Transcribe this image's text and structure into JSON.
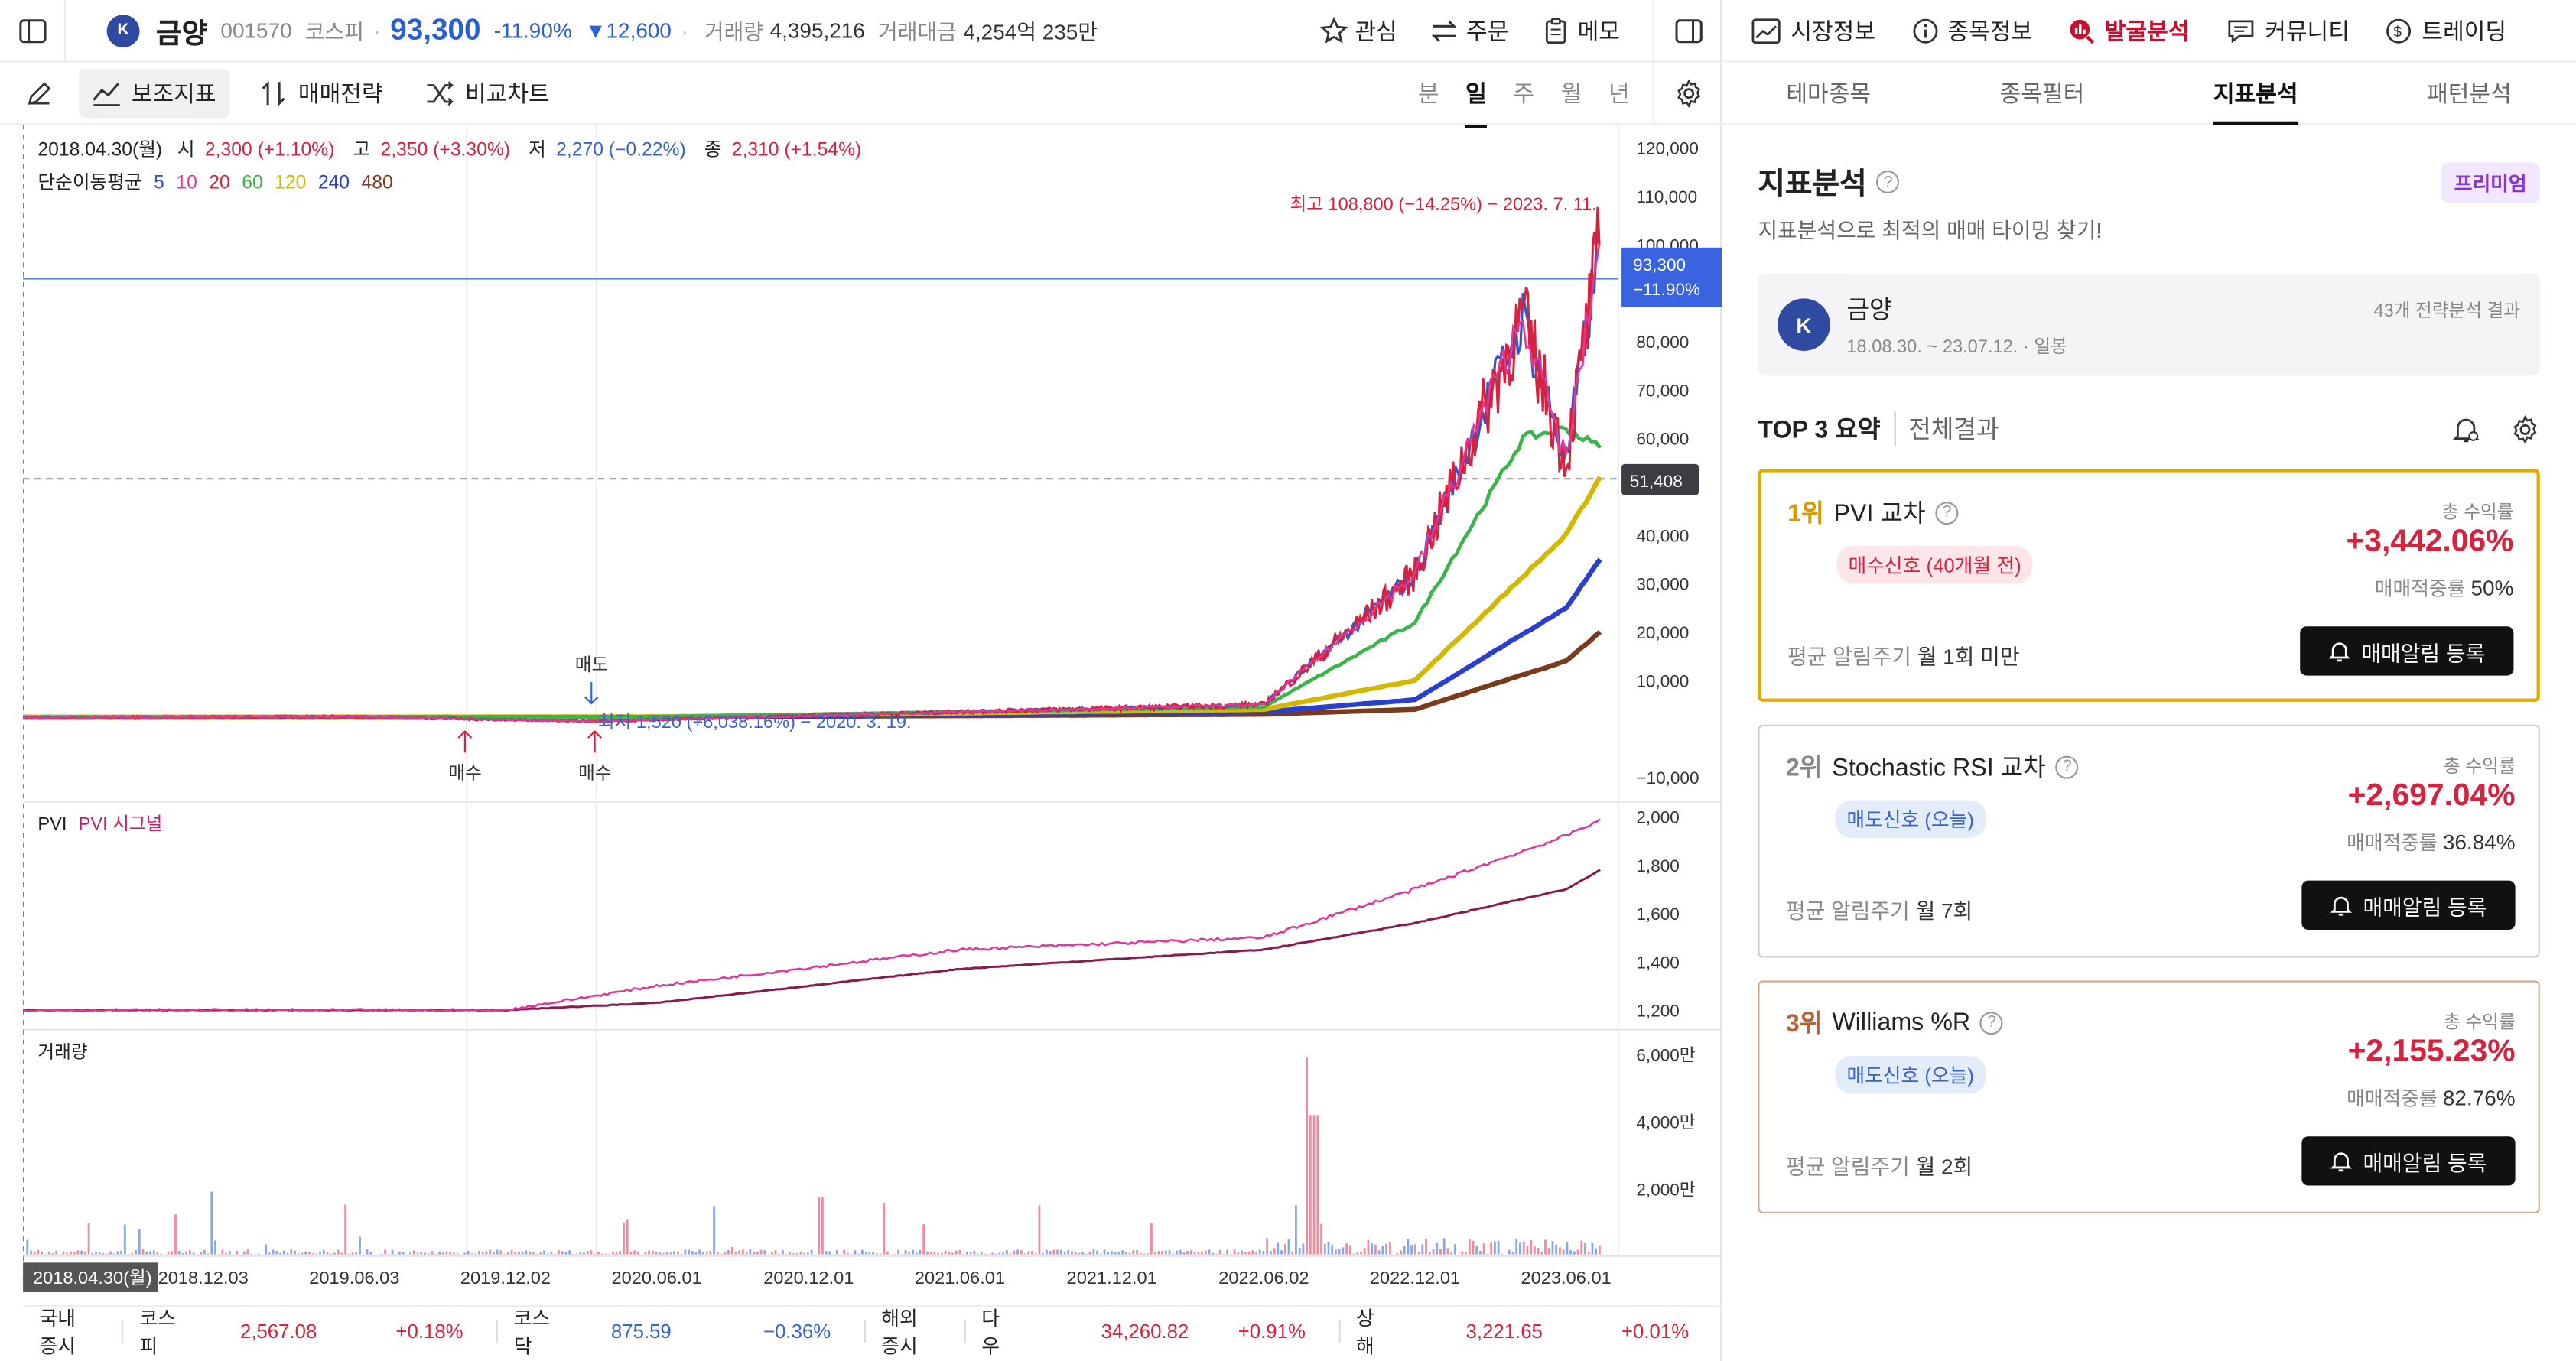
{
  "header": {
    "stock_name": "금양",
    "stock_code": "001570",
    "market": "코스피",
    "price": "93,300",
    "change_pct": "-11.90%",
    "change_amt": "▼12,600",
    "volume_label": "거래량",
    "volume": "4,395,216",
    "amount_label": "거래대금",
    "amount": "4,254억 235만",
    "buttons": [
      "관심",
      "주문",
      "메모"
    ]
  },
  "toolbar": {
    "indicator": "보조지표",
    "strategy": "매매전략",
    "compare": "비교차트",
    "periods": [
      "분",
      "일",
      "주",
      "월",
      "년"
    ],
    "active_period": "일"
  },
  "chart": {
    "ohlc": {
      "date": "2018.04.30(월)",
      "open_label": "시",
      "open": "2,300 (+1.10%)",
      "high_label": "고",
      "high": "2,350 (+3.30%)",
      "low_label": "저",
      "low": "2,270 (−0.22%)",
      "close_label": "종",
      "close": "2,310 (+1.54%)"
    },
    "ma_label": "단순이동평균",
    "ma_periods": [
      "5",
      "10",
      "20",
      "60",
      "120",
      "240",
      "480"
    ],
    "ma_colors": [
      "#3355cc",
      "#e0389a",
      "#d8223d",
      "#3cb44b",
      "#d4b800",
      "#2a3fcf",
      "#7a3b1c"
    ],
    "max_label": "최고 108,800 (−14.25%) − 2023. 7. 11.",
    "min_label": "최저 1,520 (+6,038.16%) − 2020. 3. 19.",
    "current_price_tag": "93,300",
    "current_change_tag": "−11.90%",
    "dashed_price_tag": "51,408",
    "price_ticks": [
      "120,000",
      "110,000",
      "100,000",
      "90,000",
      "80,000",
      "70,000",
      "60,000",
      "50,000",
      "40,000",
      "30,000",
      "20,000",
      "10,000",
      "−10,000"
    ],
    "sell_marker": "매도",
    "buy_markers": [
      "매수",
      "매수"
    ],
    "pvi_label": "PVI",
    "pvi_signal_label": "PVI 시그널",
    "pvi_ticks": [
      "2,000",
      "1,800",
      "1,600",
      "1,400",
      "1,200"
    ],
    "volume_panel_label": "거래량",
    "volume_ticks": [
      "6,000만",
      "4,000만",
      "2,000만"
    ],
    "x_ticks": [
      "2018.12.03",
      "2019.06.03",
      "2019.12.02",
      "2020.06.01",
      "2020.12.01",
      "2021.06.01",
      "2021.12.01",
      "2022.06.02",
      "2022.12.01",
      "2023.06.01"
    ],
    "cursor_date": "2018.04.30(월)"
  },
  "chart_data": {
    "type": "line",
    "x_range": [
      "2018-04-30",
      "2023-07-12"
    ],
    "series": [
      {
        "name": "5",
        "x": [
          "2018-04-30",
          "2019-06-03",
          "2020-03-19",
          "2021-06-01",
          "2022-06-02",
          "2022-12-01",
          "2023-04-10",
          "2023-06-01",
          "2023-07-11"
        ],
        "values": [
          2300,
          2500,
          1520,
          3500,
          5000,
          32000,
          85000,
          55000,
          100000
        ]
      },
      {
        "name": "120",
        "x": [
          "2018-04-30",
          "2020-06-01",
          "2022-06-02",
          "2022-12-01",
          "2023-06-01",
          "2023-07-12"
        ],
        "values": [
          2400,
          2500,
          4000,
          10000,
          40000,
          52000
        ]
      },
      {
        "name": "240",
        "x": [
          "2018-04-30",
          "2020-06-01",
          "2022-06-02",
          "2022-12-01",
          "2023-06-01",
          "2023-07-12"
        ],
        "values": [
          2400,
          2400,
          3500,
          6000,
          25000,
          35000
        ]
      },
      {
        "name": "480",
        "x": [
          "2018-04-30",
          "2020-06-01",
          "2022-06-02",
          "2022-12-01",
          "2023-06-01",
          "2023-07-12"
        ],
        "values": [
          2400,
          2400,
          3000,
          4000,
          14000,
          20000
        ]
      }
    ],
    "pvi": {
      "x": [
        "2018-04-30",
        "2019-12-02",
        "2020-06-01",
        "2021-06-01",
        "2022-06-02",
        "2022-12-01",
        "2023-06-01",
        "2023-07-12"
      ],
      "pvi": [
        1200,
        1200,
        1300,
        1450,
        1500,
        1700,
        1920,
        1990
      ],
      "signal": [
        1200,
        1200,
        1230,
        1370,
        1450,
        1560,
        1700,
        1780
      ]
    }
  },
  "footer": {
    "domestic_label": "국내 증시",
    "kospi_label": "코스피",
    "kospi": "2,567.08",
    "kospi_chg": "+0.18%",
    "kosdaq_label": "코스닥",
    "kosdaq": "875.59",
    "kosdaq_chg": "−0.36%",
    "overseas_label": "해외 증시",
    "dow_label": "다우",
    "dow": "34,260.82",
    "dow_chg": "+0.91%",
    "sh_label": "상해",
    "sh": "3,221.65",
    "sh_chg": "+0.01%"
  },
  "right": {
    "nav": [
      "시장정보",
      "종목정보",
      "발굴분석",
      "커뮤니티",
      "트레이딩"
    ],
    "active_nav": "발굴분석",
    "tabs": [
      "테마종목",
      "종목필터",
      "지표분석",
      "패턴분석"
    ],
    "active_tab": "지표분석",
    "title": "지표분석",
    "premium": "프리미엄",
    "subtitle": "지표분석으로 최적의 매매 타이밍 찾기!",
    "stock_name": "금양",
    "period": "18.08.30. ~ 23.07.12. · 일봉",
    "result_count": "43개 전략분석 결과",
    "top3_label": "TOP 3 요약",
    "all_results": "전체결과",
    "total_return_label": "총 수익률",
    "accuracy_label": "매매적중률",
    "alert_button": "매매알림 등록",
    "cards": [
      {
        "rank": "1위",
        "name": "PVI 교차",
        "signal": "매수신호 (40개월 전)",
        "return": "+3,442.06%",
        "accuracy": "50%",
        "cycle_label": "평균 알림주기",
        "cycle": "월 1회 미만"
      },
      {
        "rank": "2위",
        "name": "Stochastic RSI 교차",
        "signal": "매도신호 (오늘)",
        "return": "+2,697.04%",
        "accuracy": "36.84%",
        "cycle_label": "평균 알림주기",
        "cycle": "월 7회"
      },
      {
        "rank": "3위",
        "name": "Williams %R",
        "signal": "매도신호 (오늘)",
        "return": "+2,155.23%",
        "accuracy": "82.76%",
        "cycle_label": "평균 알림주기",
        "cycle": "월 2회"
      }
    ]
  }
}
